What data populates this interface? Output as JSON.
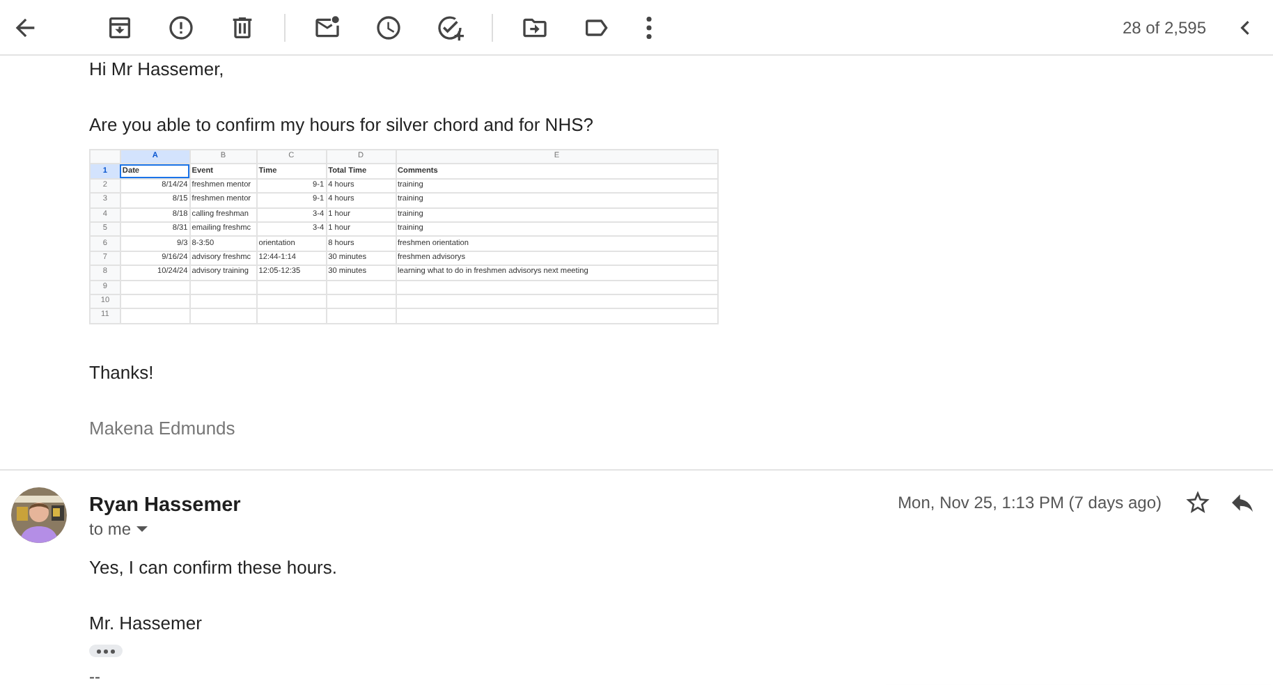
{
  "toolbar": {
    "count": "28 of 2,595"
  },
  "messages": [
    {
      "kind": "quoted",
      "greeting": "Hi Mr Hassemer,",
      "question": "Are you able to confirm my hours for silver chord and for NHS?",
      "sheet": {
        "columns": [
          {
            "label": "A",
            "selected": true
          },
          {
            "label": "B",
            "selected": false
          },
          {
            "label": "C",
            "selected": false
          },
          {
            "label": "D",
            "selected": false
          },
          {
            "label": "E",
            "selected": false
          }
        ],
        "rows": [
          {
            "number": "1",
            "selected": true,
            "bold": true,
            "cells": [
              {
                "text": "Date",
                "kind": "text"
              },
              {
                "text": "Event",
                "kind": "text"
              },
              {
                "text": "Time",
                "kind": "text"
              },
              {
                "text": "Total Time",
                "kind": "text"
              },
              {
                "text": "Comments",
                "kind": "text"
              }
            ]
          },
          {
            "number": "2",
            "selected": false,
            "bold": false,
            "cells": [
              {
                "text": "8/14/24",
                "kind": "number"
              },
              {
                "text": "freshmen mentor",
                "kind": "text"
              },
              {
                "text": "9-1",
                "kind": "number"
              },
              {
                "text": "4 hours",
                "kind": "text"
              },
              {
                "text": "training",
                "kind": "text"
              }
            ]
          },
          {
            "number": "3",
            "selected": false,
            "bold": false,
            "cells": [
              {
                "text": "8/15",
                "kind": "number"
              },
              {
                "text": "freshmen mentor",
                "kind": "text"
              },
              {
                "text": "9-1",
                "kind": "number"
              },
              {
                "text": "4 hours",
                "kind": "text"
              },
              {
                "text": "training",
                "kind": "text"
              }
            ]
          },
          {
            "number": "4",
            "selected": false,
            "bold": false,
            "cells": [
              {
                "text": "8/18",
                "kind": "number"
              },
              {
                "text": "calling freshman",
                "kind": "text"
              },
              {
                "text": "3-4",
                "kind": "number"
              },
              {
                "text": "1 hour",
                "kind": "text"
              },
              {
                "text": "training",
                "kind": "text"
              }
            ]
          },
          {
            "number": "5",
            "selected": false,
            "bold": false,
            "cells": [
              {
                "text": "8/31",
                "kind": "number"
              },
              {
                "text": "emailing freshmc",
                "kind": "text"
              },
              {
                "text": "3-4",
                "kind": "number"
              },
              {
                "text": "1 hour",
                "kind": "text"
              },
              {
                "text": "training",
                "kind": "text"
              }
            ]
          },
          {
            "number": "6",
            "selected": false,
            "bold": false,
            "cells": [
              {
                "text": "9/3",
                "kind": "number"
              },
              {
                "text": "8-3:50",
                "kind": "text"
              },
              {
                "text": "orientation",
                "kind": "text"
              },
              {
                "text": "8 hours",
                "kind": "text"
              },
              {
                "text": "freshmen orientation",
                "kind": "text"
              }
            ]
          },
          {
            "number": "7",
            "selected": false,
            "bold": false,
            "cells": [
              {
                "text": "9/16/24",
                "kind": "number"
              },
              {
                "text": "advisory freshmc",
                "kind": "text"
              },
              {
                "text": "12:44-1:14",
                "kind": "text"
              },
              {
                "text": "30 minutes",
                "kind": "text"
              },
              {
                "text": "freshmen advisorys",
                "kind": "text"
              }
            ]
          },
          {
            "number": "8",
            "selected": false,
            "bold": false,
            "cells": [
              {
                "text": "10/24/24",
                "kind": "number"
              },
              {
                "text": "advisory training",
                "kind": "text"
              },
              {
                "text": "12:05-12:35",
                "kind": "text"
              },
              {
                "text": "30 minutes",
                "kind": "text"
              },
              {
                "text": "learning what to do in freshmen advisorys next meeting",
                "kind": "text"
              }
            ]
          },
          {
            "number": "9",
            "selected": false,
            "bold": false,
            "cells": []
          },
          {
            "number": "10",
            "selected": false,
            "bold": false,
            "cells": []
          },
          {
            "number": "11",
            "selected": false,
            "bold": false,
            "cells": []
          }
        ]
      },
      "closing": "Thanks!",
      "signature": "Makena Edmunds"
    },
    {
      "kind": "full",
      "sender": "Ryan Hassemer",
      "recipient": "to me",
      "date": "Mon, Nov 25, 1:13 PM (7 days ago)",
      "starred": false,
      "body": [
        "Yes, I can confirm these hours.",
        "Mr. Hassemer"
      ],
      "separator": "--"
    }
  ]
}
